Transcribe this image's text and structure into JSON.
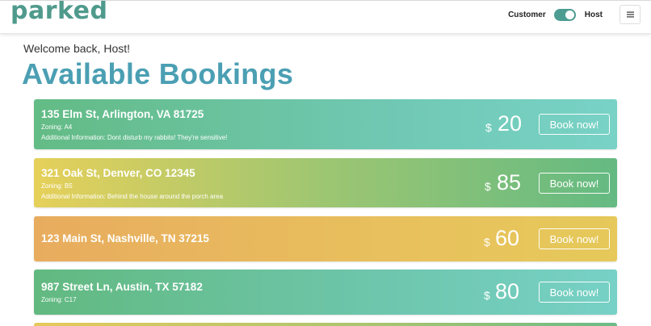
{
  "header": {
    "logo": "parked",
    "toggle": {
      "left_label": "Customer",
      "right_label": "Host",
      "state": "Host"
    },
    "menu_icon": "hamburger-icon"
  },
  "welcome": "Welcome back, Host!",
  "page_title": "Available Bookings",
  "bookings": [
    {
      "address": "135 Elm St, Arlington, VA 81725",
      "zoning": "Zoning: A4",
      "info": "Additional Information: Dont disturb my rabbits! They're sensitive!",
      "currency": "$",
      "price": "20",
      "button": "Book now!"
    },
    {
      "address": "321 Oak St, Denver, CO 12345",
      "zoning": "Zoning: B5",
      "info": "Additional Information: Behind the house around the porch area",
      "currency": "$",
      "price": "85",
      "button": "Book now!"
    },
    {
      "address": "123 Main St, Nashville, TN 37215",
      "currency": "$",
      "price": "60",
      "button": "Book now!"
    },
    {
      "address": "987 Street Ln, Austin, TX 57182",
      "zoning": "Zoning: C17",
      "currency": "$",
      "price": "80",
      "button": "Book now!"
    }
  ],
  "colors": {
    "brand": "#4f9a8c",
    "title": "#4b9fb3",
    "toggle": "#4c9c91"
  }
}
